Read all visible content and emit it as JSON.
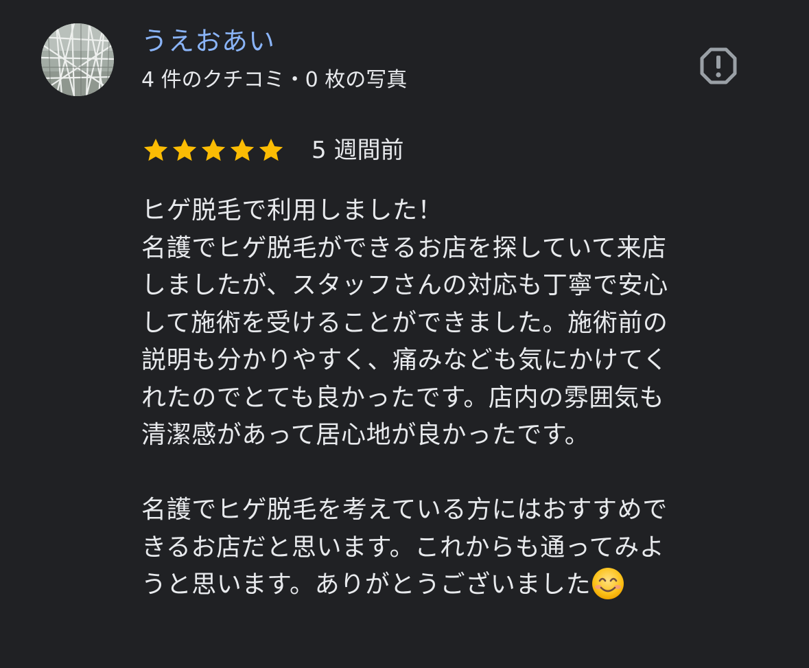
{
  "reviewer": {
    "name": "うえおあい",
    "meta": "4 件のクチコミ・0 枚の写真",
    "avatar_icon": "profile-photo-ferris-wheel"
  },
  "actions": {
    "report_icon": "report-flag-icon"
  },
  "review": {
    "rating": 5,
    "rating_max": 5,
    "star_color": "#fbbc04",
    "date": "5 週間前",
    "lines": [
      "ヒゲ脱毛で利用しました！",
      "名護でヒゲ脱毛ができるお店を探していて来店",
      "しましたが、スタッフさんの対応も丁寧で安心",
      "して施術を受けることができました。施術前の",
      "説明も分かりやすく、痛みなども気にかけてく",
      "れたのでとても良かったです。店内の雰囲気も",
      "清潔感があって居心地が良かったです。",
      "",
      "名護でヒゲ脱毛を考えている方にはおすすめで",
      "きるお店だと思います。これからも通ってみよ",
      "うと思います。ありがとうございました"
    ],
    "trailing_emoji": "smiling-face-emoji"
  },
  "colors": {
    "background": "#202124",
    "name_link": "#8ab4f8",
    "text": "#e8eaed",
    "icon": "#9aa0a6"
  }
}
